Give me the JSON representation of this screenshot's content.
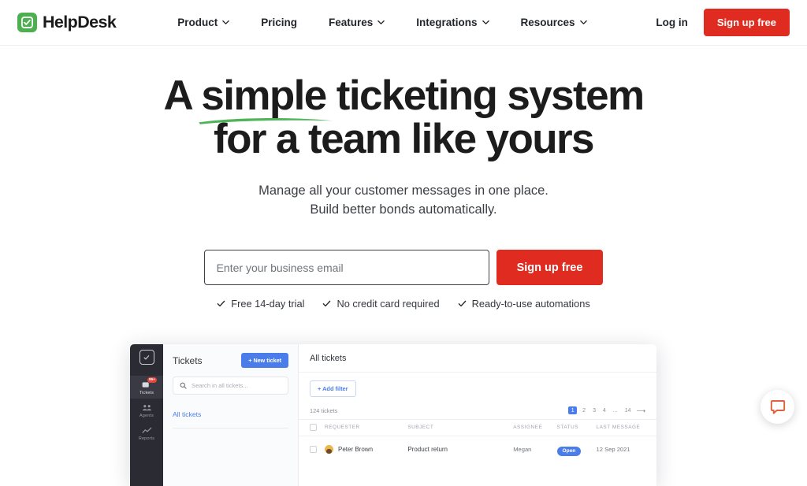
{
  "brand": {
    "name": "HelpDesk",
    "logo_icon": "check-square-icon",
    "green": "#4cb050",
    "red": "#e02b20",
    "blue": "#4a7dea"
  },
  "header": {
    "nav": [
      {
        "label": "Product",
        "has_dropdown": true
      },
      {
        "label": "Pricing",
        "has_dropdown": false
      },
      {
        "label": "Features",
        "has_dropdown": true
      },
      {
        "label": "Integrations",
        "has_dropdown": true
      },
      {
        "label": "Resources",
        "has_dropdown": true
      }
    ],
    "login_label": "Log in",
    "signup_label": "Sign up free"
  },
  "hero": {
    "headline_line1_pre": "A ",
    "headline_underlined_word": "simple",
    "headline_line1_post": " ticketing system",
    "headline_line2": "for a team like yours",
    "subhead_line1": "Manage all your customer messages in one place.",
    "subhead_line2": "Build better bonds automatically.",
    "email_placeholder": "Enter your business email",
    "email_value": "",
    "signup_button": "Sign up free",
    "perks": [
      "Free 14-day trial",
      "No credit card required",
      "Ready-to-use automations"
    ]
  },
  "app_preview": {
    "sidebar": [
      {
        "label": "Tickets",
        "icon": "ticket-icon",
        "badge": "99+",
        "active": true
      },
      {
        "label": "Agents",
        "icon": "agents-icon",
        "badge": "",
        "active": false
      },
      {
        "label": "Reports",
        "icon": "reports-icon",
        "badge": "",
        "active": false
      }
    ],
    "list_panel": {
      "title": "Tickets",
      "new_ticket_button": "+ New ticket",
      "search_placeholder": "Search in all tickets...",
      "views": [
        "All tickets"
      ]
    },
    "main_panel": {
      "title": "All tickets",
      "add_filter_button": "+ Add filter",
      "ticket_count": "124 tickets",
      "pagination": [
        "1",
        "2",
        "3",
        "4",
        "...",
        "14"
      ],
      "pagination_active": "1",
      "columns": [
        "REQUESTER",
        "SUBJECT",
        "ASSIGNEE",
        "STATUS",
        "LAST MESSAGE"
      ],
      "rows": [
        {
          "requester": "Peter Brown",
          "subject": "Product return",
          "assignee": "Megan",
          "status": "Open",
          "last_message": "12 Sep 2021"
        }
      ]
    }
  },
  "chat_widget": {
    "icon": "chat-bubble-icon",
    "color": "#e2603a"
  }
}
